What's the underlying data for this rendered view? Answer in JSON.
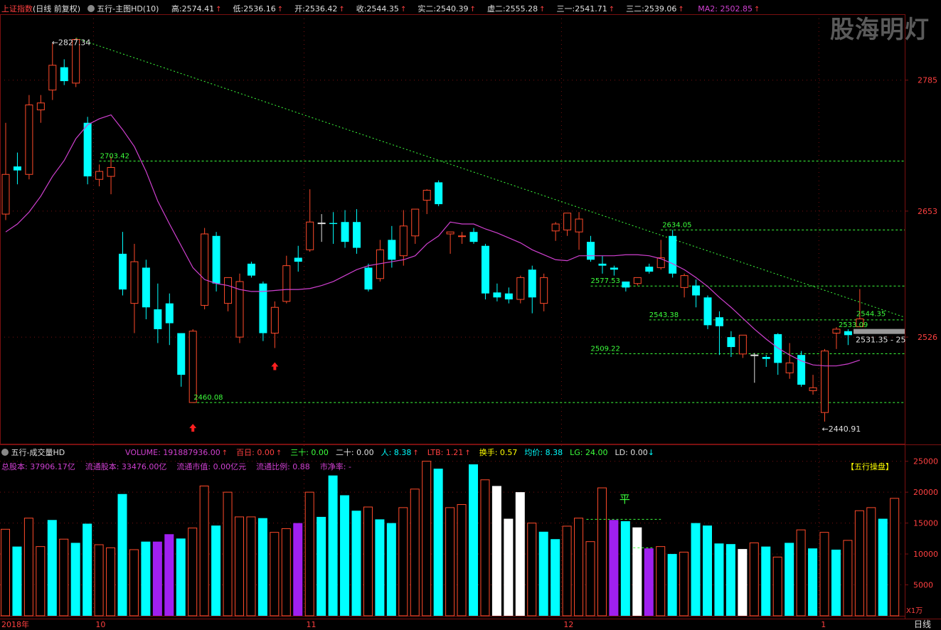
{
  "header": {
    "index_name": "上证指数",
    "mode": "(日线 前复权)",
    "main_title": "五行-主图HD(10)",
    "fields": [
      {
        "label": "高:",
        "value": "2574.41"
      },
      {
        "label": "低:",
        "value": "2536.16"
      },
      {
        "label": "开:",
        "value": "2536.42"
      },
      {
        "label": "收:",
        "value": "2544.35"
      },
      {
        "label": "实二:",
        "value": "2540.39"
      },
      {
        "label": "虚二:",
        "value": "2555.28"
      },
      {
        "label": "三一:",
        "value": "2541.71"
      },
      {
        "label": "三二:",
        "value": "2539.06"
      }
    ],
    "ma_label": "MA2:",
    "ma_value": "2502.85",
    "up_arrow": "↑"
  },
  "watermark": "股海明灯",
  "colors": {
    "up": "#ff4a2a",
    "down": "#00ffff",
    "ma": "#d040d0",
    "grid": "#7a1010",
    "level": "#3cff3c"
  },
  "main_axis": {
    "ticks": [
      "2785",
      "2653",
      "2526"
    ],
    "side_label": "2531.35 - 25"
  },
  "price_labels": {
    "high": "2827.34",
    "low_left": "2460.08",
    "low_right": "2440.91",
    "levels": [
      "2703.42",
      "2634.05",
      "2577.53",
      "2543.38",
      "2509.22",
      "2533.09",
      "2544.35"
    ]
  },
  "volume_header": {
    "title": "五行-成交量HD",
    "items": [
      {
        "label": "VOLUME:",
        "value": "191887936.00"
      },
      {
        "label": "百日:",
        "value": "0.00"
      },
      {
        "label": "三十:",
        "value": "0.00"
      },
      {
        "label": "二十:",
        "value": "0.00"
      },
      {
        "label": "人:",
        "value": "8.38"
      },
      {
        "label": "LTB:",
        "value": "1.21"
      },
      {
        "label": "换手:",
        "value": "0.57"
      },
      {
        "label": "均价:",
        "value": "8.38"
      },
      {
        "label": "LG:",
        "value": "24.00"
      },
      {
        "label": "LD:",
        "value": "0.00"
      }
    ],
    "line2": [
      {
        "label": "总股本:",
        "value": "37906.17亿"
      },
      {
        "label": "流通股本:",
        "value": "33476.00亿"
      },
      {
        "label": "流通市值:",
        "value": "0.00亿元"
      },
      {
        "label": "流通比例:",
        "value": "0.88"
      },
      {
        "label": "市净率:",
        "value": "-"
      }
    ],
    "badge": "【五行操盘】",
    "flat_mark": "平",
    "down_arrow": "↓"
  },
  "volume_axis": {
    "ticks": [
      "25000",
      "20000",
      "15000",
      "10000",
      "5000"
    ],
    "unit": "X1万"
  },
  "date_axis": {
    "labels": [
      "2018年",
      "10",
      "11",
      "12",
      "1"
    ],
    "period": "日线"
  },
  "chart_data": [
    {
      "type": "candlestick",
      "title": "五行-主图HD(10)",
      "y_ticks": [
        2785,
        2653,
        2526
      ],
      "ylim": [
        2420,
        2850
      ],
      "candles": [
        {
          "o": 2650,
          "h": 2742,
          "l": 2644,
          "c": 2690,
          "dir": "up"
        },
        {
          "o": 2694,
          "h": 2712,
          "l": 2680,
          "c": 2698,
          "dir": "down"
        },
        {
          "o": 2690,
          "h": 2770,
          "l": 2685,
          "c": 2760,
          "dir": "up"
        },
        {
          "o": 2755,
          "h": 2770,
          "l": 2742,
          "c": 2762,
          "dir": "up"
        },
        {
          "o": 2775,
          "h": 2822,
          "l": 2765,
          "c": 2800,
          "dir": "up"
        },
        {
          "o": 2798,
          "h": 2806,
          "l": 2780,
          "c": 2784,
          "dir": "down"
        },
        {
          "o": 2782,
          "h": 2827.34,
          "l": 2778,
          "c": 2826,
          "dir": "up"
        },
        {
          "o": 2742,
          "h": 2748,
          "l": 2680,
          "c": 2688,
          "dir": "down"
        },
        {
          "o": 2685,
          "h": 2700,
          "l": 2678,
          "c": 2693,
          "dir": "up"
        },
        {
          "o": 2688,
          "h": 2708,
          "l": 2670,
          "c": 2697,
          "dir": "up"
        },
        {
          "o": 2610,
          "h": 2632,
          "l": 2568,
          "c": 2574,
          "dir": "down"
        },
        {
          "o": 2560,
          "h": 2620,
          "l": 2530,
          "c": 2602,
          "dir": "up"
        },
        {
          "o": 2596,
          "h": 2604,
          "l": 2544,
          "c": 2556,
          "dir": "down"
        },
        {
          "o": 2554,
          "h": 2580,
          "l": 2520,
          "c": 2534,
          "dir": "down"
        },
        {
          "o": 2560,
          "h": 2570,
          "l": 2518,
          "c": 2540,
          "dir": "down"
        },
        {
          "o": 2530,
          "h": 2530,
          "l": 2476,
          "c": 2488,
          "dir": "down"
        },
        {
          "o": 2460.08,
          "h": 2534,
          "l": 2460.08,
          "c": 2532,
          "dir": "up"
        },
        {
          "o": 2558,
          "h": 2636,
          "l": 2554,
          "c": 2630,
          "dir": "up"
        },
        {
          "o": 2628,
          "h": 2632,
          "l": 2572,
          "c": 2580,
          "dir": "down"
        },
        {
          "o": 2560,
          "h": 2580,
          "l": 2552,
          "c": 2586,
          "dir": "up"
        },
        {
          "o": 2526,
          "h": 2590,
          "l": 2520,
          "c": 2582,
          "dir": "up"
        },
        {
          "o": 2600,
          "h": 2602,
          "l": 2586,
          "c": 2588,
          "dir": "down"
        },
        {
          "o": 2580,
          "h": 2582,
          "l": 2522,
          "c": 2530,
          "dir": "down"
        },
        {
          "o": 2530,
          "h": 2562,
          "l": 2515,
          "c": 2556,
          "dir": "up"
        },
        {
          "o": 2562,
          "h": 2608,
          "l": 2560,
          "c": 2598,
          "dir": "up"
        },
        {
          "o": 2606,
          "h": 2618,
          "l": 2592,
          "c": 2602,
          "dir": "down"
        },
        {
          "o": 2614,
          "h": 2675,
          "l": 2612,
          "c": 2642,
          "dir": "up"
        },
        {
          "o": 2641,
          "h": 2650,
          "l": 2622,
          "c": 2641,
          "dir": "flat"
        },
        {
          "o": 2640,
          "h": 2652,
          "l": 2620,
          "c": 2641,
          "dir": "down"
        },
        {
          "o": 2642,
          "h": 2654,
          "l": 2616,
          "c": 2622,
          "dir": "down"
        },
        {
          "o": 2642,
          "h": 2655,
          "l": 2610,
          "c": 2616,
          "dir": "down"
        },
        {
          "o": 2596,
          "h": 2600,
          "l": 2572,
          "c": 2574,
          "dir": "down"
        },
        {
          "o": 2585,
          "h": 2624,
          "l": 2582,
          "c": 2614,
          "dir": "up"
        },
        {
          "o": 2624,
          "h": 2638,
          "l": 2596,
          "c": 2604,
          "dir": "down"
        },
        {
          "o": 2608,
          "h": 2654,
          "l": 2598,
          "c": 2638,
          "dir": "up"
        },
        {
          "o": 2628,
          "h": 2652,
          "l": 2620,
          "c": 2655,
          "dir": "up"
        },
        {
          "o": 2664,
          "h": 2675,
          "l": 2650,
          "c": 2674,
          "dir": "up"
        },
        {
          "o": 2682,
          "h": 2684,
          "l": 2658,
          "c": 2660,
          "dir": "down"
        },
        {
          "o": 2630,
          "h": 2632,
          "l": 2610,
          "c": 2632,
          "dir": "up"
        },
        {
          "o": 2628,
          "h": 2632,
          "l": 2620,
          "c": 2628,
          "dir": "up"
        },
        {
          "o": 2632,
          "h": 2636,
          "l": 2620,
          "c": 2622,
          "dir": "down"
        },
        {
          "o": 2618,
          "h": 2620,
          "l": 2564,
          "c": 2570,
          "dir": "down"
        },
        {
          "o": 2571,
          "h": 2580,
          "l": 2562,
          "c": 2566,
          "dir": "down"
        },
        {
          "o": 2570,
          "h": 2576,
          "l": 2560,
          "c": 2564,
          "dir": "down"
        },
        {
          "o": 2564,
          "h": 2588,
          "l": 2560,
          "c": 2586,
          "dir": "up"
        },
        {
          "o": 2594,
          "h": 2598,
          "l": 2550,
          "c": 2566,
          "dir": "down"
        },
        {
          "o": 2560,
          "h": 2590,
          "l": 2552,
          "c": 2586,
          "dir": "up"
        },
        {
          "o": 2633,
          "h": 2642,
          "l": 2623,
          "c": 2640,
          "dir": "up"
        },
        {
          "o": 2634,
          "h": 2644,
          "l": 2628,
          "c": 2651,
          "dir": "up"
        },
        {
          "o": 2632,
          "h": 2652,
          "l": 2614,
          "c": 2645,
          "dir": "up"
        },
        {
          "o": 2622,
          "h": 2628,
          "l": 2602,
          "c": 2604,
          "dir": "down"
        },
        {
          "o": 2600,
          "h": 2608,
          "l": 2590,
          "c": 2598,
          "dir": "down"
        },
        {
          "o": 2596,
          "h": 2598,
          "l": 2588,
          "c": 2594,
          "dir": "down"
        },
        {
          "o": 2576,
          "h": 2582,
          "l": 2572,
          "c": 2582,
          "dir": "down"
        },
        {
          "o": 2580,
          "h": 2586,
          "l": 2578,
          "c": 2586,
          "dir": "up"
        },
        {
          "o": 2597,
          "h": 2600,
          "l": 2590,
          "c": 2592,
          "dir": "down"
        },
        {
          "o": 2596,
          "h": 2624,
          "l": 2594,
          "c": 2606,
          "dir": "up"
        },
        {
          "o": 2628,
          "h": 2634.05,
          "l": 2586,
          "c": 2590,
          "dir": "down"
        },
        {
          "o": 2576,
          "h": 2590,
          "l": 2566,
          "c": 2588,
          "dir": "up"
        },
        {
          "o": 2578,
          "h": 2584,
          "l": 2556,
          "c": 2568,
          "dir": "down"
        },
        {
          "o": 2566,
          "h": 2568,
          "l": 2534,
          "c": 2538,
          "dir": "down"
        },
        {
          "o": 2546,
          "h": 2552,
          "l": 2508,
          "c": 2537,
          "dir": "down"
        },
        {
          "o": 2526,
          "h": 2532,
          "l": 2506,
          "c": 2516,
          "dir": "down"
        },
        {
          "o": 2509,
          "h": 2528,
          "l": 2505,
          "c": 2528,
          "dir": "up"
        },
        {
          "o": 2508,
          "h": 2510,
          "l": 2480,
          "c": 2508,
          "dir": "flat"
        },
        {
          "o": 2506,
          "h": 2508,
          "l": 2496,
          "c": 2504,
          "dir": "down"
        },
        {
          "o": 2500,
          "h": 2530,
          "l": 2488,
          "c": 2529,
          "dir": "down"
        },
        {
          "o": 2490,
          "h": 2520,
          "l": 2484,
          "c": 2500,
          "dir": "up"
        },
        {
          "o": 2508,
          "h": 2512,
          "l": 2476,
          "c": 2478,
          "dir": "down"
        },
        {
          "o": 2472,
          "h": 2488,
          "l": 2468,
          "c": 2475,
          "dir": "up"
        },
        {
          "o": 2450,
          "h": 2514,
          "l": 2440.91,
          "c": 2512,
          "dir": "up"
        },
        {
          "o": 2530,
          "h": 2536,
          "l": 2514,
          "c": 2534,
          "dir": "up"
        },
        {
          "o": 2532,
          "h": 2534,
          "l": 2518,
          "c": 2528,
          "dir": "down"
        },
        {
          "o": 2536.42,
          "h": 2574.41,
          "l": 2536.16,
          "c": 2544.35,
          "dir": "up"
        }
      ],
      "ma2": [
        2632,
        2640,
        2652,
        2668,
        2688,
        2704,
        2726,
        2740,
        2746,
        2750,
        2735,
        2718,
        2693,
        2663,
        2640,
        2618,
        2596,
        2584,
        2580,
        2578,
        2574,
        2572,
        2572,
        2573,
        2574,
        2574,
        2575,
        2578,
        2582,
        2588,
        2594,
        2598,
        2600,
        2602,
        2604,
        2608,
        2620,
        2628,
        2642,
        2640,
        2640,
        2635,
        2631,
        2626,
        2621,
        2614,
        2609,
        2604,
        2603,
        2608,
        2608,
        2608,
        2608,
        2609,
        2609,
        2608,
        2605,
        2600,
        2594,
        2586,
        2577,
        2566,
        2556,
        2545,
        2534,
        2524,
        2515,
        2508,
        2502,
        2498,
        2497,
        2497,
        2499,
        2502.85
      ],
      "levels": [
        2703.42,
        2634.05,
        2577.53,
        2543.38,
        2509.22,
        2460.08
      ]
    },
    {
      "type": "bar",
      "title": "五行-成交量HD",
      "unit": "X1万",
      "y_ticks": [
        25000,
        20000,
        15000,
        10000,
        5000
      ],
      "ylim": [
        0,
        26000
      ],
      "values": [
        14000,
        11200,
        15800,
        11200,
        15500,
        12400,
        11800,
        14900,
        11500,
        11000,
        19700,
        10700,
        12000,
        12000,
        13200,
        12500,
        14200,
        21000,
        14600,
        20000,
        16000,
        16000,
        15800,
        13500,
        14100,
        15000,
        20000,
        16000,
        22700,
        19500,
        17000,
        17600,
        15600,
        15000,
        17500,
        20500,
        25000,
        23800,
        17500,
        18000,
        24500,
        22000,
        21000,
        15700,
        20000,
        15000,
        13600,
        12400,
        14500,
        15800,
        12000,
        20700,
        15500,
        15300,
        14300,
        10900,
        11200,
        10000,
        10300,
        15000,
        14600,
        11700,
        11600,
        10800,
        11800,
        11200,
        9500,
        11800,
        13900,
        10900,
        13500,
        10700,
        12200,
        17000,
        17500,
        15700,
        19000
      ],
      "dir": [
        "up",
        "down",
        "up",
        "up",
        "down",
        "up",
        "down",
        "down",
        "up",
        "up",
        "down",
        "up",
        "down",
        "magenta",
        "magenta",
        "down",
        "up",
        "up",
        "down",
        "up",
        "up",
        "up",
        "down",
        "up",
        "up",
        "magenta",
        "up",
        "down",
        "down",
        "down",
        "down",
        "up",
        "down",
        "down",
        "up",
        "up",
        "up",
        "down",
        "up",
        "up",
        "down",
        "up",
        "white",
        "white",
        "white",
        "up",
        "down",
        "down",
        "up",
        "up",
        "up",
        "up",
        "magenta",
        "down",
        "white",
        "magenta",
        "up",
        "down",
        "up",
        "down",
        "down",
        "down",
        "down",
        "white",
        "up",
        "down",
        "up",
        "down",
        "up",
        "down",
        "up",
        "down",
        "up",
        "up",
        "up",
        "down",
        "up"
      ]
    }
  ]
}
